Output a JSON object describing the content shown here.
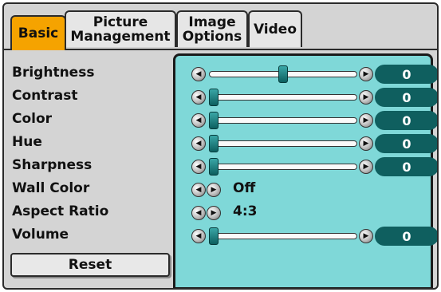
{
  "tabs": [
    {
      "line1": "Basic",
      "line2": ""
    },
    {
      "line1": "Picture",
      "line2": "Management"
    },
    {
      "line1": "Image",
      "line2": "Options"
    },
    {
      "line1": "Video",
      "line2": ""
    }
  ],
  "active_tab": "Basic",
  "settings": [
    {
      "label": "Brightness",
      "type": "slider",
      "value": "0",
      "level": 0.5
    },
    {
      "label": "Contrast",
      "type": "slider",
      "value": "0",
      "level": 0.0
    },
    {
      "label": "Color",
      "type": "slider",
      "value": "0",
      "level": 0.0
    },
    {
      "label": "Hue",
      "type": "slider",
      "value": "0",
      "level": 0.0
    },
    {
      "label": "Sharpness",
      "type": "slider",
      "value": "0",
      "level": 0.0
    },
    {
      "label": "Wall Color",
      "type": "option",
      "value": "Off"
    },
    {
      "label": "Aspect Ratio",
      "type": "option",
      "value": "4:3"
    },
    {
      "label": "Volume",
      "type": "slider",
      "value": "0",
      "level": 0.0
    }
  ],
  "reset_label": "Reset",
  "colors": {
    "active_tab": "#f5a300",
    "panel": "#7fd8d8",
    "value_bg": "#0f5f5f"
  },
  "icons": {
    "left_arrow": "left-arrow-icon",
    "right_arrow": "right-arrow-icon"
  }
}
